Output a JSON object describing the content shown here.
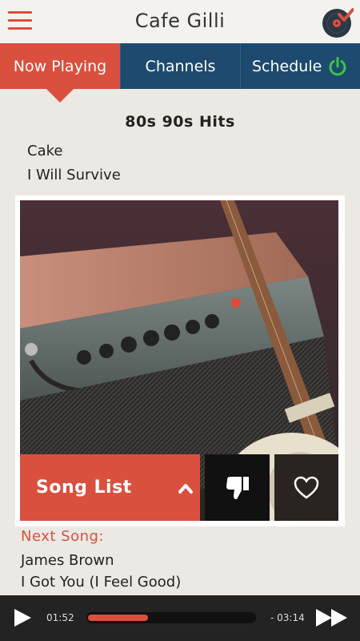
{
  "header": {
    "title": "Cafe Gilli",
    "menu_icon": "hamburger-menu-icon",
    "logo_icon": "vinyl-record-check-logo"
  },
  "tabs": [
    {
      "label": "Now Playing",
      "active": true
    },
    {
      "label": "Channels",
      "active": false
    },
    {
      "label": "Schedule",
      "active": false,
      "icon": "power-icon"
    }
  ],
  "now_playing": {
    "channel": "80s 90s Hits",
    "artist": "Cake",
    "song": "I Will Survive",
    "artwork_icon": "guitar-amplifier-image"
  },
  "controls": {
    "song_list_label": "Song List",
    "song_list_icon": "chevron-up-icon",
    "dislike_icon": "thumbs-down-icon",
    "like_icon": "heart-icon"
  },
  "next": {
    "label": "Next Song:",
    "artist": "James Brown",
    "song": "I Got You (I Feel Good)"
  },
  "player": {
    "elapsed": "01:52",
    "remaining": "- 03:14",
    "progress": 0.36,
    "play_icon": "play-icon",
    "forward_icon": "fast-forward-icon"
  },
  "colors": {
    "accent": "#d9503f",
    "nav": "#1d4a6e",
    "player_bg": "#232323",
    "power_green": "#3cc24a"
  }
}
